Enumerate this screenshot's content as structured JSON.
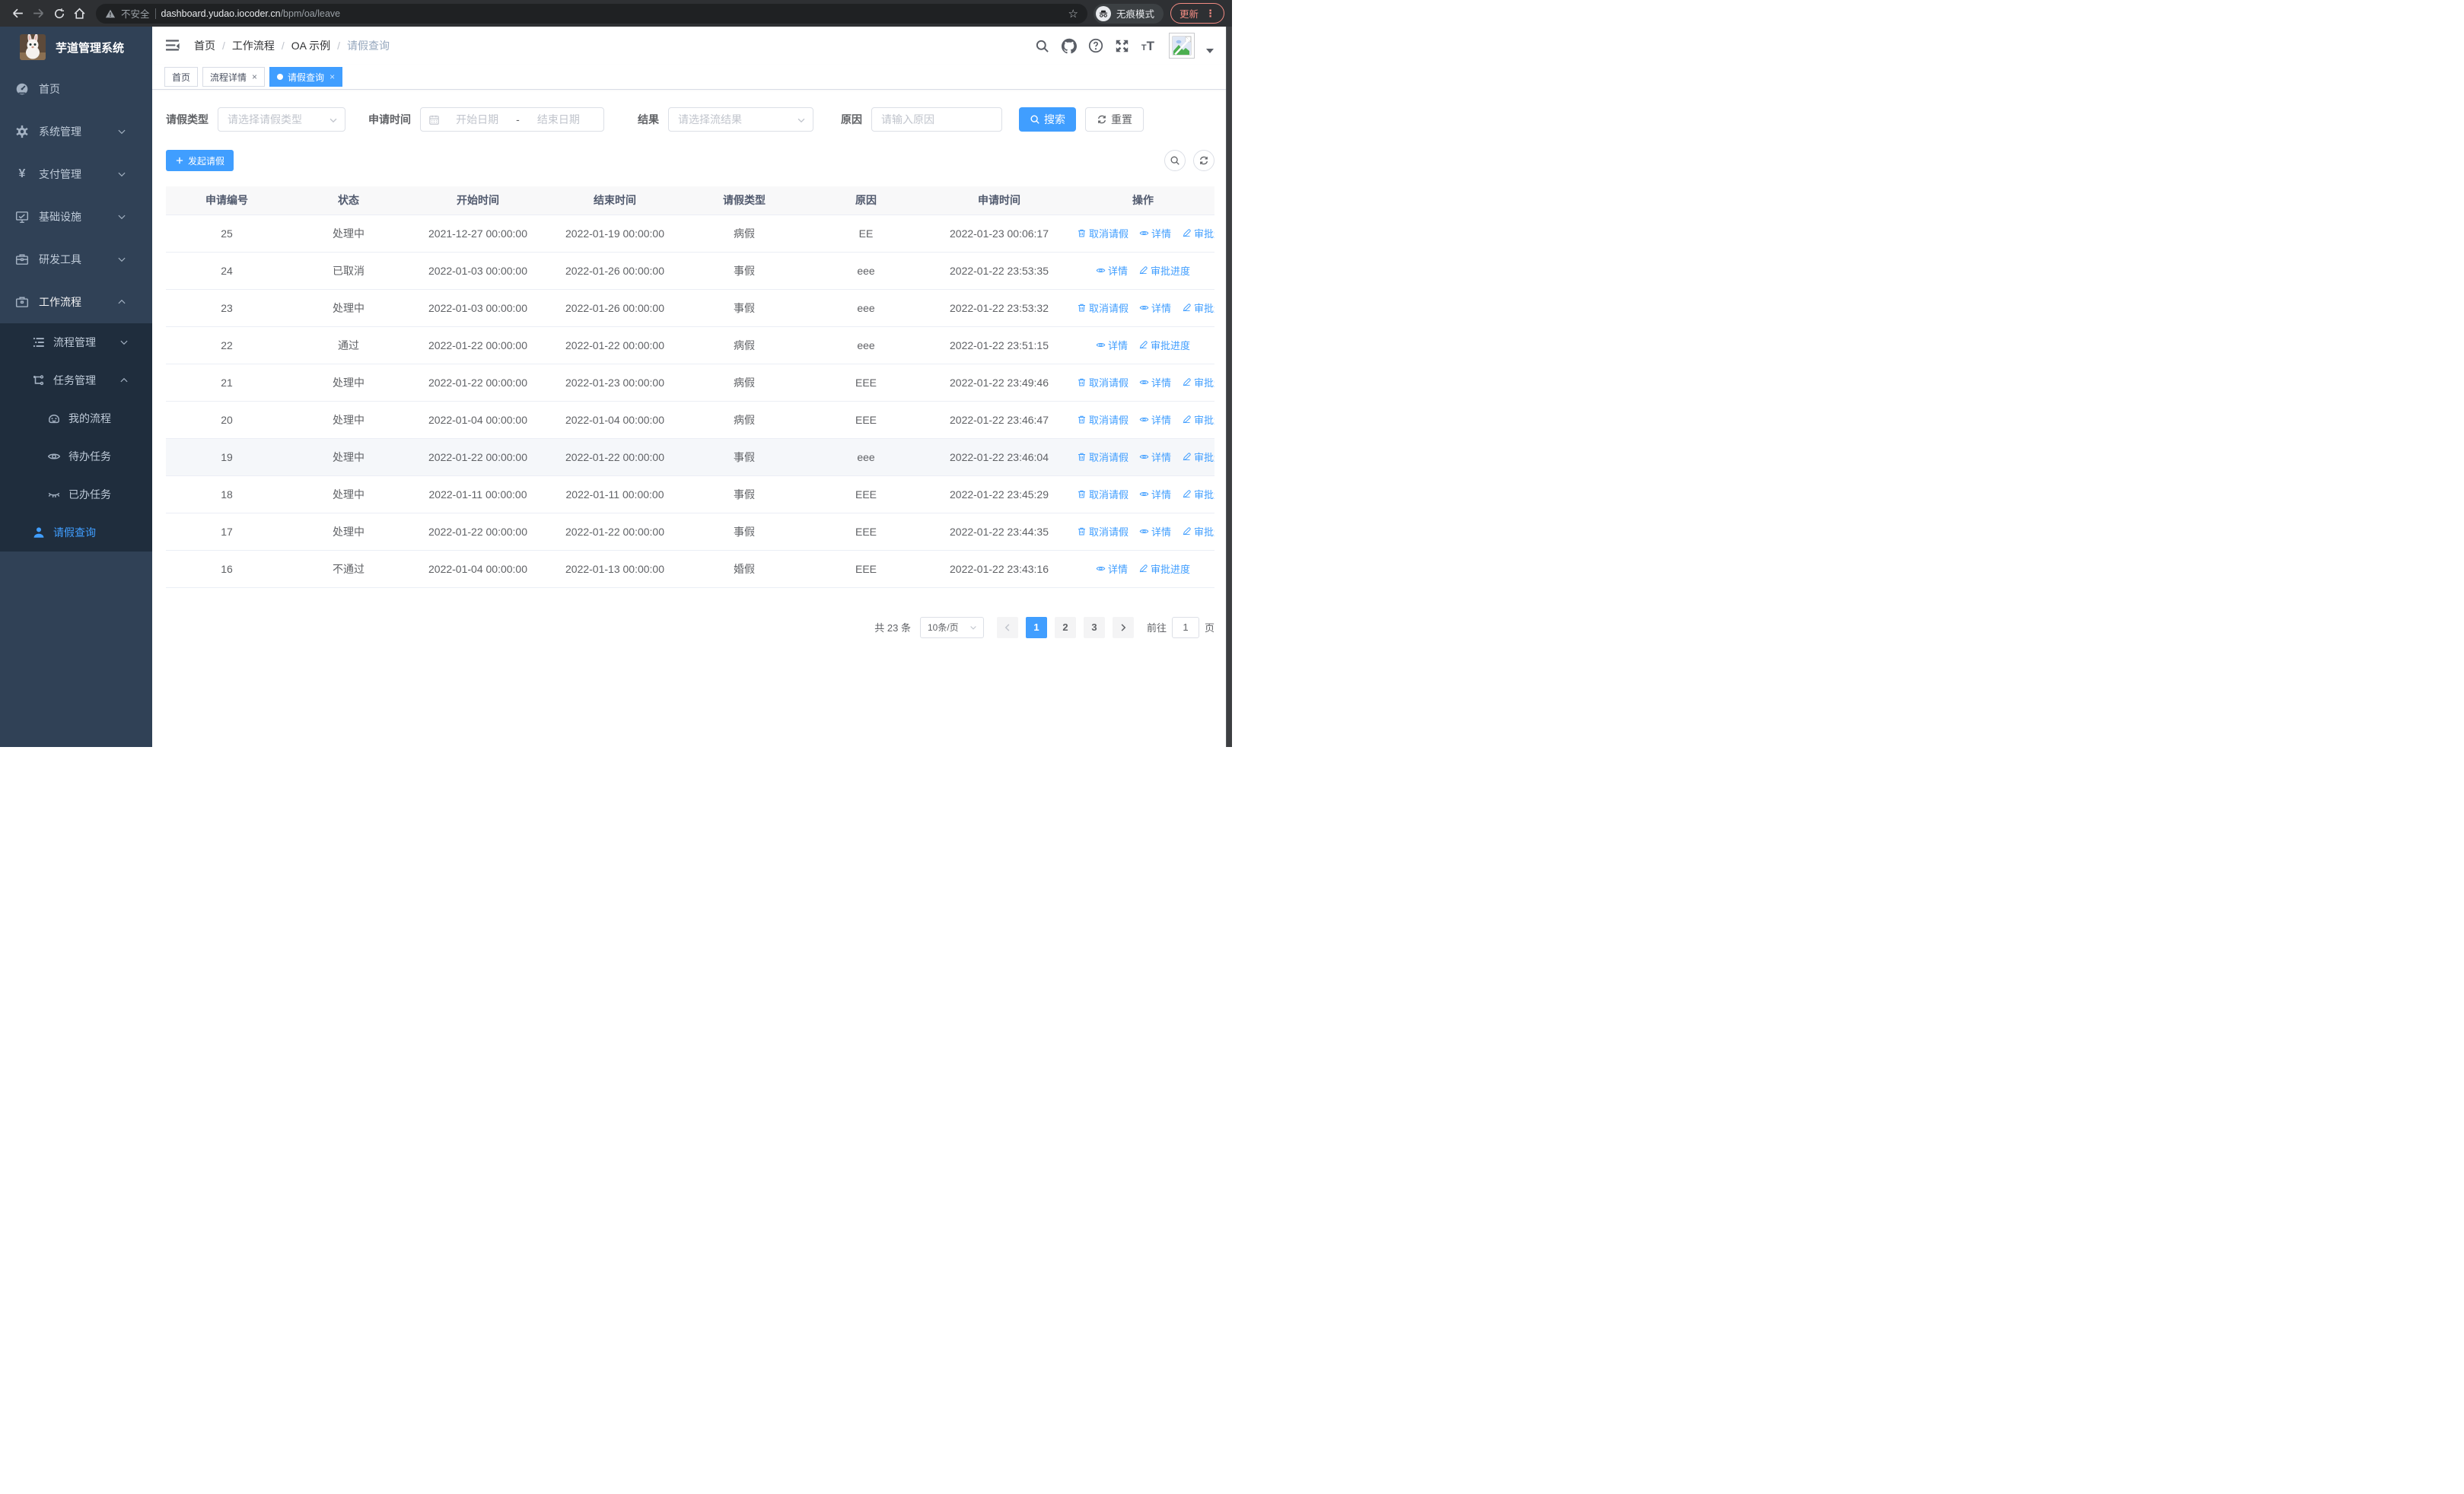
{
  "colors": {
    "primary": "#409eff",
    "sidebar_bg": "#304156",
    "submenu_bg": "#1f2d3d",
    "update_accent": "#f28b82"
  },
  "browser": {
    "security_label": "不安全",
    "url_host": "dashboard.yudao.iocoder.cn",
    "url_path": "/bpm/oa/leave",
    "incognito_label": "无痕模式",
    "update_label": "更新"
  },
  "sidebar": {
    "title": "芋道管理系统",
    "items": [
      {
        "label": "首页",
        "icon": "dashboard-icon",
        "chevron": ""
      },
      {
        "label": "系统管理",
        "icon": "gear-icon",
        "chevron": "down"
      },
      {
        "label": "支付管理",
        "icon": "yen-icon",
        "chevron": "down"
      },
      {
        "label": "基础设施",
        "icon": "monitor-icon",
        "chevron": "down"
      },
      {
        "label": "研发工具",
        "icon": "toolbox-icon",
        "chevron": "down"
      },
      {
        "label": "工作流程",
        "icon": "briefcase-icon",
        "chevron": "up",
        "expanded": true
      }
    ],
    "submenu": [
      {
        "label": "流程管理",
        "icon": "list-tree-icon",
        "chevron": "down",
        "level": 1
      },
      {
        "label": "任务管理",
        "icon": "flow-icon",
        "chevron": "up",
        "level": 1
      },
      {
        "label": "我的流程",
        "icon": "face-icon",
        "level": 2
      },
      {
        "label": "待办任务",
        "icon": "eye-icon",
        "level": 2
      },
      {
        "label": "已办任务",
        "icon": "eye-closed-icon",
        "level": 2
      },
      {
        "label": "请假查询",
        "icon": "user-icon",
        "level": 1,
        "active": true
      }
    ]
  },
  "header": {
    "breadcrumb": [
      "首页",
      "工作流程",
      "OA 示例",
      "请假查询"
    ],
    "separator": "/",
    "icons": [
      "search-icon",
      "github-icon",
      "help-icon",
      "fullscreen-icon",
      "font-size-icon"
    ]
  },
  "tabs": [
    {
      "label": "首页",
      "closable": false,
      "active": false
    },
    {
      "label": "流程详情",
      "closable": true,
      "active": false
    },
    {
      "label": "请假查询",
      "closable": true,
      "active": true
    }
  ],
  "filters": {
    "leave_type_label": "请假类型",
    "leave_type_placeholder": "请选择请假类型",
    "apply_time_label": "申请时间",
    "date_start_placeholder": "开始日期",
    "date_separator": "-",
    "date_end_placeholder": "结束日期",
    "result_label": "结果",
    "result_placeholder": "请选择流结果",
    "reason_label": "原因",
    "reason_placeholder": "请输入原因",
    "search_label": "搜索",
    "reset_label": "重置"
  },
  "toolbar": {
    "create_label": "发起请假"
  },
  "table": {
    "columns": [
      "申请编号",
      "状态",
      "开始时间",
      "结束时间",
      "请假类型",
      "原因",
      "申请时间",
      "操作"
    ],
    "action_labels": {
      "cancel": "取消请假",
      "detail": "详情",
      "progress": "审批进度"
    },
    "action_icons": {
      "cancel": "delete-icon",
      "detail": "view-icon",
      "progress": "edit-icon"
    },
    "rows": [
      {
        "id": "25",
        "status": "处理中",
        "start": "2021-12-27 00:00:00",
        "end": "2022-01-19 00:00:00",
        "type": "病假",
        "reason": "EE",
        "applied": "2022-01-23 00:06:17",
        "actions": [
          "cancel",
          "detail",
          "progress"
        ],
        "highlight": false
      },
      {
        "id": "24",
        "status": "已取消",
        "start": "2022-01-03 00:00:00",
        "end": "2022-01-26 00:00:00",
        "type": "事假",
        "reason": "eee",
        "applied": "2022-01-22 23:53:35",
        "actions": [
          "detail",
          "progress"
        ],
        "highlight": false
      },
      {
        "id": "23",
        "status": "处理中",
        "start": "2022-01-03 00:00:00",
        "end": "2022-01-26 00:00:00",
        "type": "事假",
        "reason": "eee",
        "applied": "2022-01-22 23:53:32",
        "actions": [
          "cancel",
          "detail",
          "progress"
        ],
        "highlight": false
      },
      {
        "id": "22",
        "status": "通过",
        "start": "2022-01-22 00:00:00",
        "end": "2022-01-22 00:00:00",
        "type": "病假",
        "reason": "eee",
        "applied": "2022-01-22 23:51:15",
        "actions": [
          "detail",
          "progress"
        ],
        "highlight": false
      },
      {
        "id": "21",
        "status": "处理中",
        "start": "2022-01-22 00:00:00",
        "end": "2022-01-23 00:00:00",
        "type": "病假",
        "reason": "EEE",
        "applied": "2022-01-22 23:49:46",
        "actions": [
          "cancel",
          "detail",
          "progress"
        ],
        "highlight": false
      },
      {
        "id": "20",
        "status": "处理中",
        "start": "2022-01-04 00:00:00",
        "end": "2022-01-04 00:00:00",
        "type": "病假",
        "reason": "EEE",
        "applied": "2022-01-22 23:46:47",
        "actions": [
          "cancel",
          "detail",
          "progress"
        ],
        "highlight": false
      },
      {
        "id": "19",
        "status": "处理中",
        "start": "2022-01-22 00:00:00",
        "end": "2022-01-22 00:00:00",
        "type": "事假",
        "reason": "eee",
        "applied": "2022-01-22 23:46:04",
        "actions": [
          "cancel",
          "detail",
          "progress"
        ],
        "highlight": true
      },
      {
        "id": "18",
        "status": "处理中",
        "start": "2022-01-11 00:00:00",
        "end": "2022-01-11 00:00:00",
        "type": "事假",
        "reason": "EEE",
        "applied": "2022-01-22 23:45:29",
        "actions": [
          "cancel",
          "detail",
          "progress"
        ],
        "highlight": false
      },
      {
        "id": "17",
        "status": "处理中",
        "start": "2022-01-22 00:00:00",
        "end": "2022-01-22 00:00:00",
        "type": "事假",
        "reason": "EEE",
        "applied": "2022-01-22 23:44:35",
        "actions": [
          "cancel",
          "detail",
          "progress"
        ],
        "highlight": false
      },
      {
        "id": "16",
        "status": "不通过",
        "start": "2022-01-04 00:00:00",
        "end": "2022-01-13 00:00:00",
        "type": "婚假",
        "reason": "EEE",
        "applied": "2022-01-22 23:43:16",
        "actions": [
          "detail",
          "progress"
        ],
        "highlight": false
      }
    ]
  },
  "pagination": {
    "total_label": "共 23 条",
    "page_size": "10条/页",
    "pages": [
      {
        "label": "1",
        "active": true
      },
      {
        "label": "2",
        "active": false
      },
      {
        "label": "3",
        "active": false
      }
    ],
    "goto_label": "前往",
    "goto_value": "1",
    "goto_suffix": "页"
  }
}
